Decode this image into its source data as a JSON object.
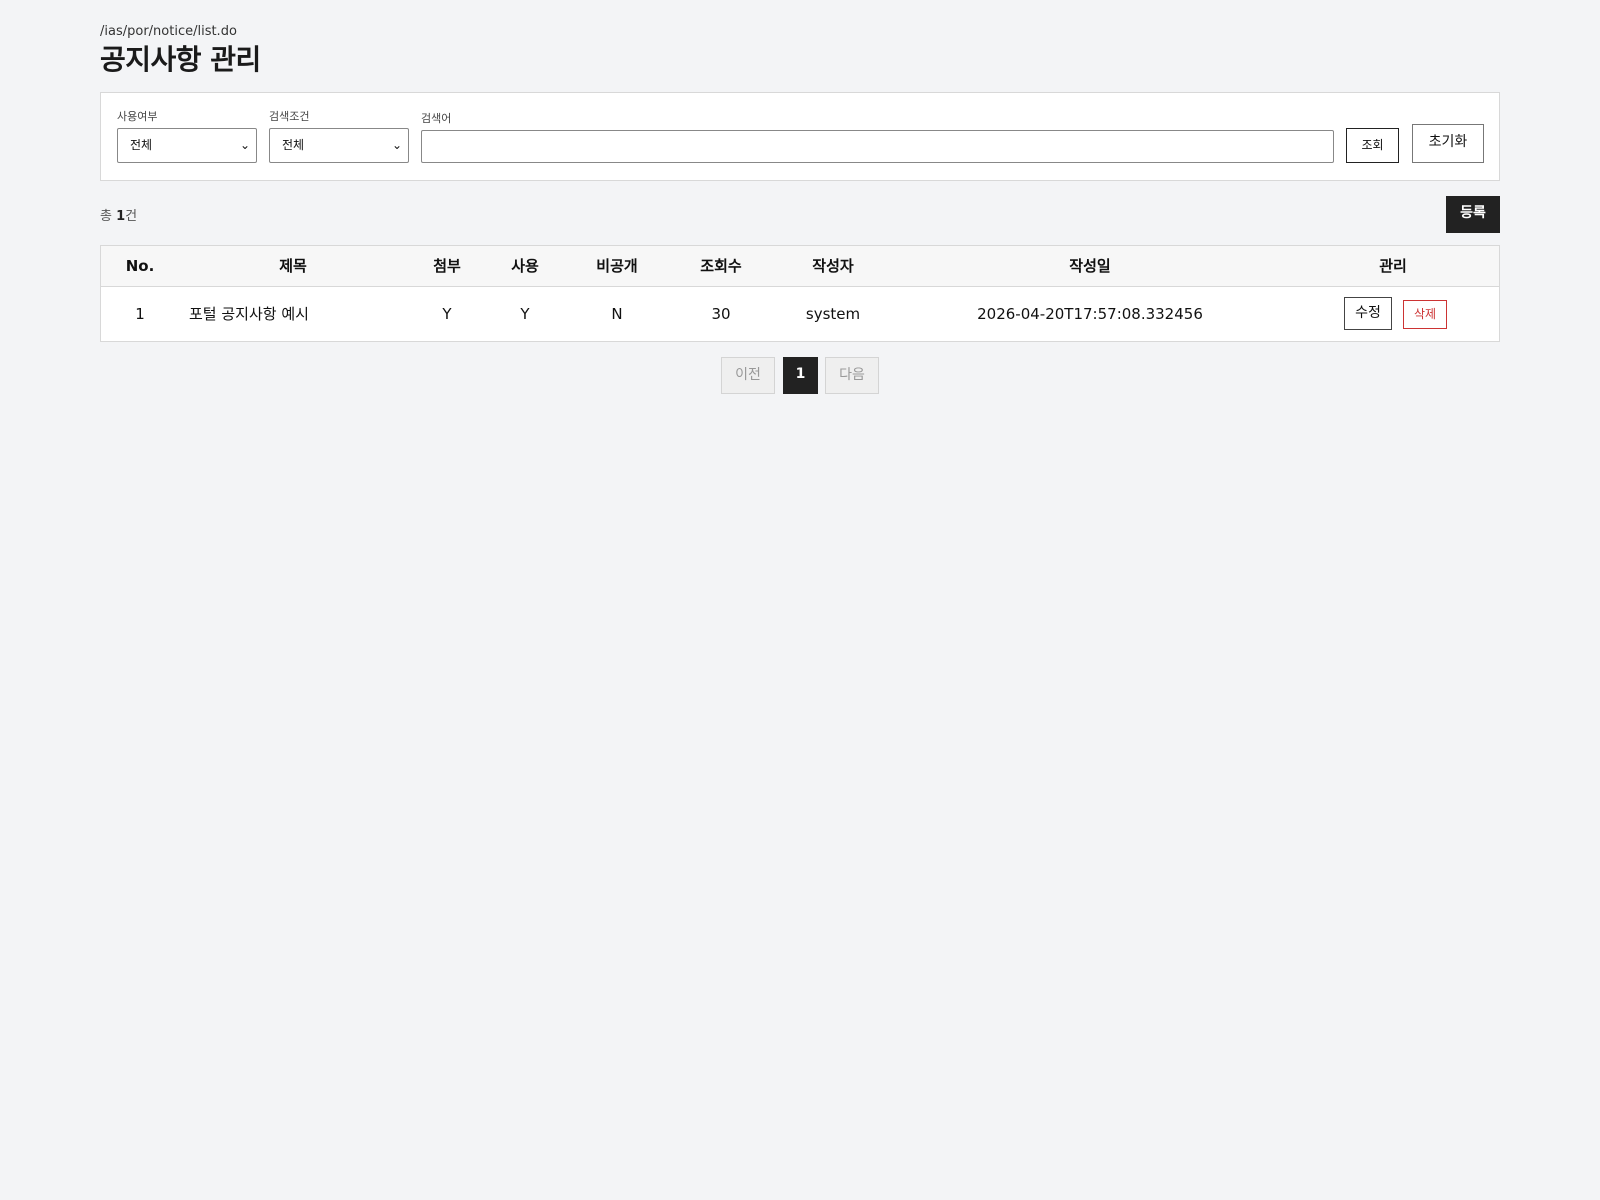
{
  "breadcrumb": "/ias/por/notice/list.do",
  "page_title": "공지사항 관리",
  "search": {
    "use_label": "사용여부",
    "use_value": "전체",
    "condition_label": "검색조건",
    "condition_value": "전체",
    "keyword_label": "검색어",
    "keyword_value": "",
    "search_button": "조회",
    "reset_button": "초기화"
  },
  "summary": {
    "prefix": "총 ",
    "count": "1",
    "suffix": "건"
  },
  "register_button": "등록",
  "table": {
    "headers": {
      "no": "No.",
      "title": "제목",
      "attach": "첨부",
      "use": "사용",
      "private": "비공개",
      "views": "조회수",
      "author": "작성자",
      "date": "작성일",
      "manage": "관리"
    },
    "rows": [
      {
        "no": "1",
        "title": "포털 공지사항 예시",
        "attach": "Y",
        "use": "Y",
        "private": "N",
        "views": "30",
        "author": "system",
        "date": "2026-04-20T17:57:08.332456",
        "edit": "수정",
        "delete": "삭제"
      }
    ]
  },
  "pagination": {
    "prev": "이전",
    "current": "1",
    "next": "다음"
  }
}
